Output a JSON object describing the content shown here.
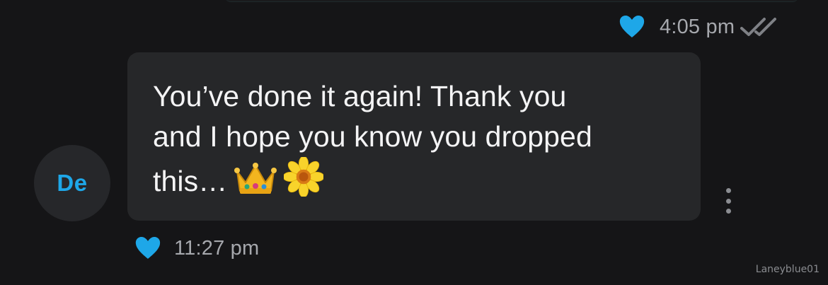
{
  "colors": {
    "background": "#151517",
    "bubble": "#262729",
    "accent_blue": "#1ea7e8",
    "meta_text": "#a6a8ad"
  },
  "outgoing_message": {
    "reaction_icon": "heart-icon",
    "time": "4:05 pm",
    "status_icon": "double-check-icon"
  },
  "incoming_message": {
    "avatar_initials": "De",
    "text": "You’ve done it again! Thank you\nand I hope you know you dropped\nthis…",
    "emojis": [
      "crown-emoji",
      "blossom-emoji"
    ],
    "reaction_icon": "heart-icon",
    "time": "11:27 pm",
    "menu_icon": "more-vertical-icon"
  },
  "watermark": "Laneyblue01"
}
